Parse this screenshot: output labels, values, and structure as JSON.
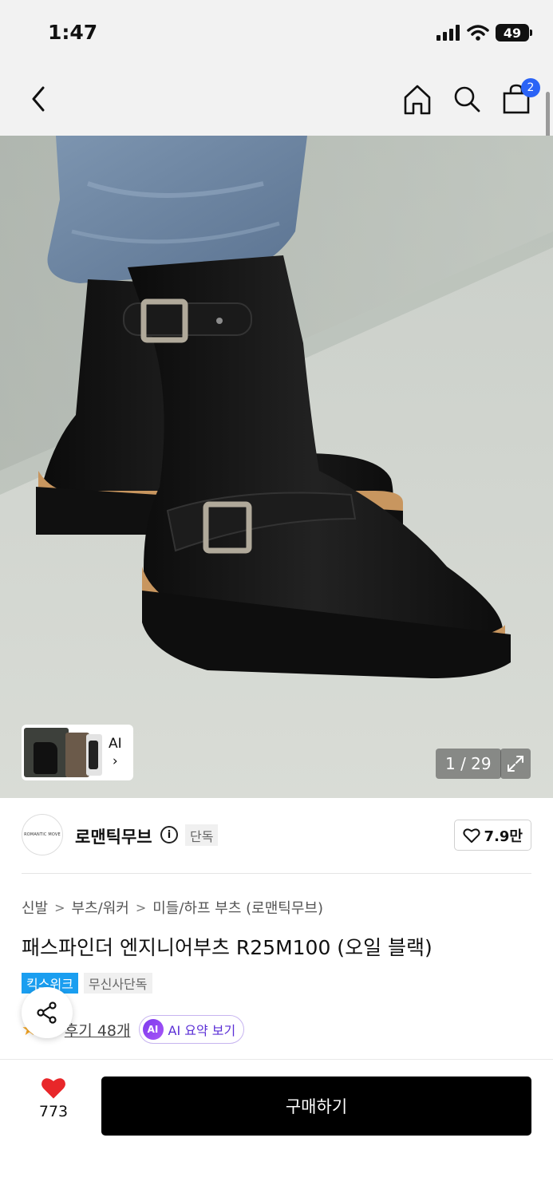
{
  "status_bar": {
    "time": "1:47",
    "battery": "49"
  },
  "nav": {
    "cart_count": "2"
  },
  "gallery": {
    "counter": "1 / 29",
    "thumb_ai_label": "AI",
    "thumb_ai_chevron": "›"
  },
  "brand": {
    "logo_text": "ROMANTIC MOVE",
    "name": "로맨틱무브",
    "info_symbol": "i",
    "exclusive_label": "단독",
    "like_count": "7.9만"
  },
  "breadcrumb": {
    "items": [
      "신발",
      "부츠/워커",
      "미들/하프 부츠 (로맨틱무브)"
    ],
    "separator": ">"
  },
  "product": {
    "title": "패스파인더 엔지니어부츠 R25M100 (오일 블랙)",
    "tags": [
      "킥스위크",
      "무신사단독"
    ],
    "rating_partial": "5",
    "review_link": "후기 48개",
    "ai_summary_icon": "AI",
    "ai_summary_label": "AI 요약 보기"
  },
  "bottom_bar": {
    "like_count": "773",
    "buy_label": "구매하기"
  },
  "colors": {
    "accent_blue": "#2b63f6",
    "tag_blue": "#1a9ef0",
    "like_red": "#e8272a",
    "ai_purple": "#7c3aed",
    "buy_button": "#000000"
  },
  "icons": {
    "back": "chevron-left-icon",
    "home": "home-icon",
    "search": "search-icon",
    "cart": "shopping-bag-icon",
    "expand": "expand-icon",
    "share": "share-icon",
    "heart": "heart-icon",
    "star": "star-icon"
  }
}
